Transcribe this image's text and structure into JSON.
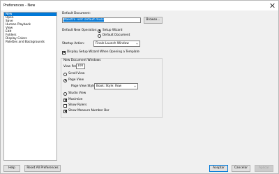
{
  "window": {
    "title": "Preferences - New"
  },
  "categories": [
    {
      "label": "New",
      "selected": true
    },
    {
      "label": "Open",
      "selected": false
    },
    {
      "label": "Save",
      "selected": false
    },
    {
      "label": "Human Playback",
      "selected": false
    },
    {
      "label": "View",
      "selected": false
    },
    {
      "label": "Edit",
      "selected": false
    },
    {
      "label": "Folders",
      "selected": false
    },
    {
      "label": "Display Colors",
      "selected": false
    },
    {
      "label": "Palettes and Backgrounds",
      "selected": false
    }
  ],
  "default_document": {
    "label": "Default Document:",
    "value": "Maestro Font Default.musx",
    "browse_label": "Browse..."
  },
  "default_new_operation": {
    "label": "Default New Operation:",
    "options": [
      {
        "label": "Setup Wizard",
        "checked": true
      },
      {
        "label": "Default Document",
        "checked": false
      }
    ]
  },
  "startup_action": {
    "label": "Startup Action:",
    "value": "Finale Launch Window"
  },
  "display_setup_wizard": {
    "label": "Display Setup Wizard When Opening a Template",
    "checked": true
  },
  "new_document_windows": {
    "label": "New Document Windows",
    "view_percent_label": "View Percent:",
    "view_percent_value": "100",
    "scroll_view_label": "Scroll View",
    "scroll_view_checked": false,
    "page_view_label": "Page View",
    "page_view_checked": true,
    "page_view_style_label": "Page View Style:",
    "page_view_style_value": "Book: Style: Row",
    "studio_view_label": "Studio View",
    "studio_view_checked": false,
    "maximize_label": "Maximize",
    "maximize_checked": true,
    "show_rulers_label": "Show Rulers",
    "show_rulers_checked": false,
    "show_measure_number_bar_label": "Show Measure Number Bar",
    "show_measure_number_bar_checked": true
  },
  "footer": {
    "help_label": "Help",
    "reset_label": "Reset All Preferences",
    "ok_label": "Aceptar",
    "cancel_label": "Cancelar",
    "apply_label": "Aplicar"
  },
  "colors": {
    "selection": "#0078d7",
    "dialog_bg": "#f0f0f0"
  }
}
